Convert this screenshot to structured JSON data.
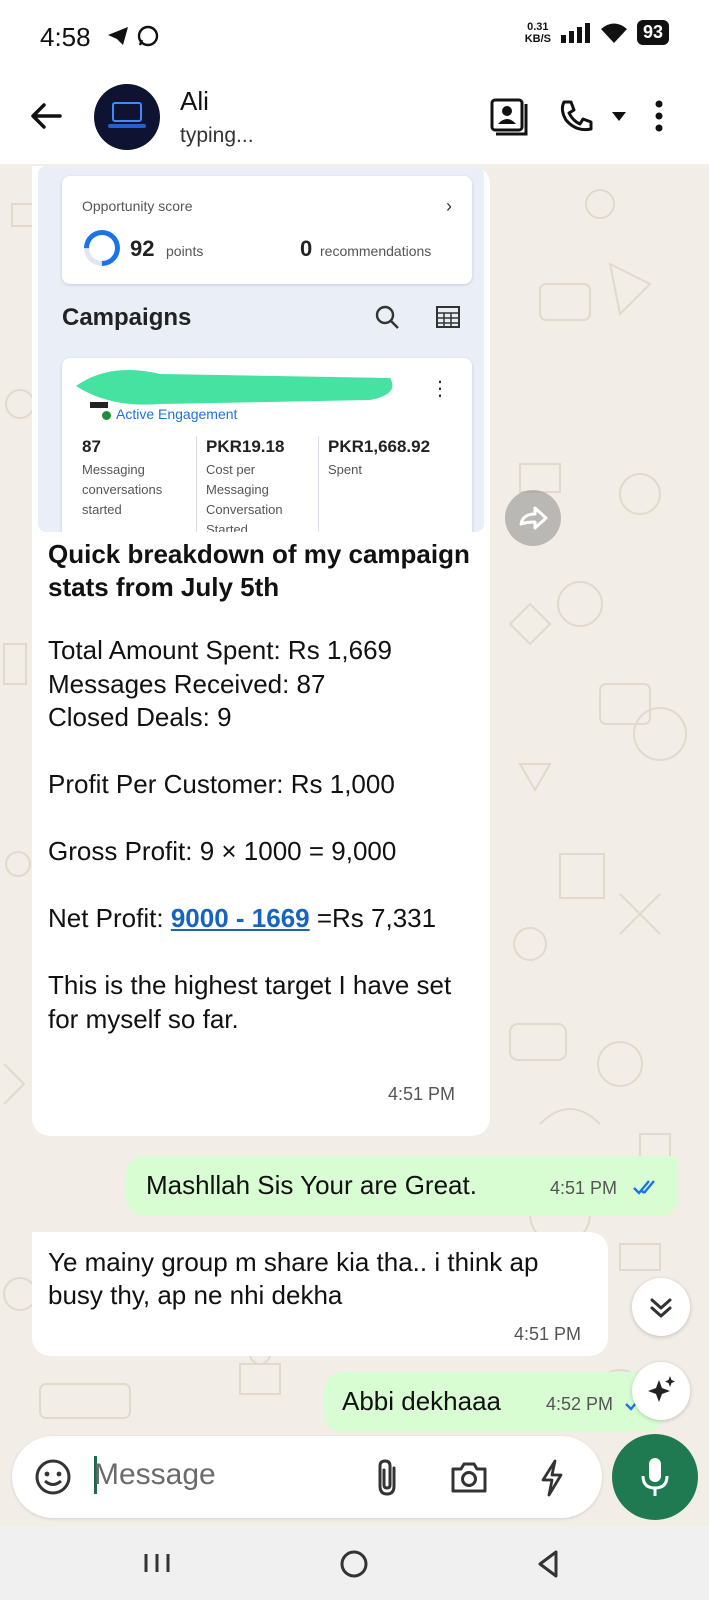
{
  "status_bar": {
    "time": "4:58",
    "net_speed_value": "0.31",
    "net_speed_unit": "KB/S",
    "battery": "93"
  },
  "header": {
    "contact_name": "Ali",
    "contact_status": "typing..."
  },
  "image_message": {
    "opportunity_title": "Opportunity score",
    "score": "92",
    "score_unit": "points",
    "recommendations_count": "0",
    "recommendations_label": "recommendations",
    "campaigns_title": "Campaigns",
    "campaign_status": "Active Engagement",
    "metrics": [
      {
        "value": "87",
        "label": "Messaging conversations started"
      },
      {
        "value": "PKR19.18",
        "label": "Cost per Messaging Conversation Started"
      },
      {
        "value": "PKR1,668.92",
        "label": "Spent"
      }
    ]
  },
  "messages": {
    "m1": {
      "caption": "Quick breakdown of my campaign stats from July 5th",
      "line1": "Total Amount Spent: Rs 1,669",
      "line2": "Messages Received: 87",
      "line3": "Closed Deals: 9",
      "line4": "Profit Per Customer: Rs 1,000",
      "line5": "Gross Profit: 9 × 1000 = 9,000",
      "line6_prefix": "Net Profit: ",
      "line6_link": "9000 - 1669",
      "line6_suffix": " =Rs 7,331",
      "line7": "This is the highest target I have set for myself so far.",
      "time": "4:51 PM"
    },
    "m2": {
      "text": "Mashllah Sis Your are Great.",
      "time": "4:51 PM"
    },
    "m3": {
      "text": "Ye mainy group m share kia tha.. i think ap busy thy, ap ne nhi dekha",
      "time": "4:51 PM"
    },
    "m4": {
      "text": "Abbi dekhaaa",
      "time": "4:52 PM"
    }
  },
  "composer": {
    "placeholder": "Message"
  },
  "colors": {
    "outgoing_bubble": "#d9fdd3",
    "accent": "#1f7a52",
    "read_tick": "#1a73e8"
  }
}
